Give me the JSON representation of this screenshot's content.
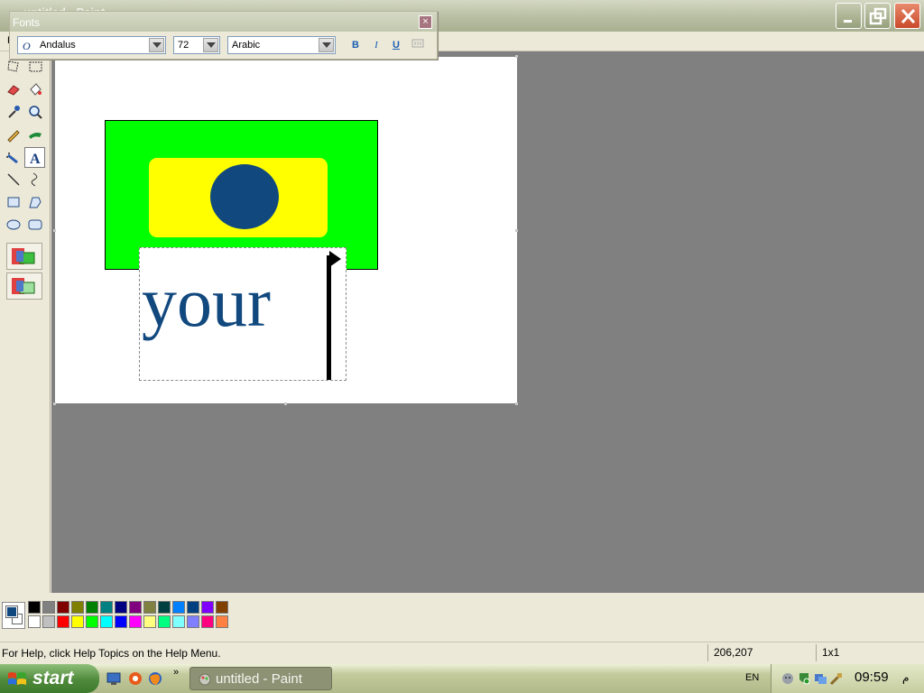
{
  "window": {
    "title": "untitled - Paint"
  },
  "menu": {
    "first_item": "F"
  },
  "fonts_toolbar": {
    "title": "Fonts",
    "font_name": "Andalus",
    "font_size": "72",
    "script": "Arabic",
    "bold_label": "B",
    "italic_label": "I",
    "underline_label": "U",
    "close_label": "×"
  },
  "canvas": {
    "typed_text": "your"
  },
  "palette": {
    "foreground": "#11497f",
    "background": "#ffffff",
    "row1": [
      "#000000",
      "#808080",
      "#800000",
      "#808000",
      "#008000",
      "#008080",
      "#000080",
      "#800080",
      "#808040",
      "#004040",
      "#0080ff",
      "#004080",
      "#8000ff",
      "#804000"
    ],
    "row2": [
      "#ffffff",
      "#c0c0c0",
      "#ff0000",
      "#ffff00",
      "#00ff00",
      "#00ffff",
      "#0000ff",
      "#ff00ff",
      "#ffff80",
      "#00ff80",
      "#80ffff",
      "#8080ff",
      "#ff0080",
      "#ff8040"
    ]
  },
  "status": {
    "help": "For Help, click Help Topics on the Help Menu.",
    "coords": "206,207",
    "size": "1x1"
  },
  "taskbar": {
    "start": "start",
    "task": "untitled - Paint",
    "lang": "EN",
    "clock": "09:59",
    "clock_suffix": "م"
  }
}
